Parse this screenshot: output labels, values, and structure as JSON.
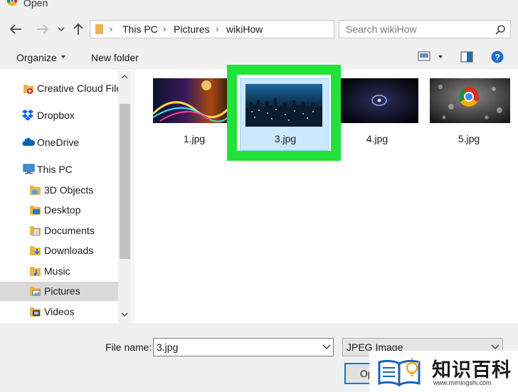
{
  "window": {
    "title": "Open"
  },
  "address": {
    "crumbs": [
      "This PC",
      "Pictures",
      "wikiHow"
    ]
  },
  "search": {
    "placeholder": "Search wikiHow"
  },
  "toolbar": {
    "organize_label": "Organize",
    "new_folder_label": "New folder"
  },
  "nav_pane": {
    "items": [
      {
        "label": "Creative Cloud File",
        "icon": "creative-cloud-icon"
      },
      {
        "label": "Dropbox",
        "icon": "dropbox-icon"
      },
      {
        "label": "OneDrive",
        "icon": "onedrive-icon"
      },
      {
        "label": "This PC",
        "icon": "computer-icon"
      },
      {
        "label": "3D Objects",
        "icon": "3d-objects-icon"
      },
      {
        "label": "Desktop",
        "icon": "desktop-icon"
      },
      {
        "label": "Documents",
        "icon": "documents-icon"
      },
      {
        "label": "Downloads",
        "icon": "downloads-icon"
      },
      {
        "label": "Music",
        "icon": "music-icon"
      },
      {
        "label": "Pictures",
        "icon": "pictures-icon",
        "selected": true
      },
      {
        "label": "Videos",
        "icon": "videos-icon"
      }
    ]
  },
  "files": [
    {
      "name": "1.jpg"
    },
    {
      "name": "3.jpg",
      "selected": true
    },
    {
      "name": "4.jpg"
    },
    {
      "name": "5.jpg"
    }
  ],
  "bottom": {
    "file_name_label": "File name:",
    "file_name_value": "3.jpg",
    "file_type_value": "JPEG Image",
    "open_label": "Op"
  },
  "watermark": {
    "text": "知识百科",
    "url": "www.mimingshi.com"
  },
  "colors": {
    "highlight": "#22e23a",
    "selection": "#cce8ff",
    "accent": "#0078d7"
  }
}
